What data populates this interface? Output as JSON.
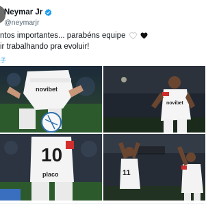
{
  "tweet": {
    "author_name": "Neymar Jr",
    "author_handle": "@neymarjr",
    "text_line1": "ntos importantes... parabéns equipe",
    "text_line2": "ir trabalhando pra evoluir!",
    "translate_label": "子"
  },
  "photos": [
    {
      "description": "player-in-action",
      "shirt_sponsor": "umbro · novibet"
    },
    {
      "description": "player-celebrating",
      "shirt_sponsor": "novibet"
    },
    {
      "description": "player-back-number",
      "shirt_number": "10",
      "shirt_sponsor": "placo"
    },
    {
      "description": "players-clapping",
      "shirt_number": "11"
    }
  ],
  "colors": {
    "text": "#0f1419",
    "handle": "#536471",
    "verified": "#1d9bf0",
    "link": "#1d9bf0"
  }
}
